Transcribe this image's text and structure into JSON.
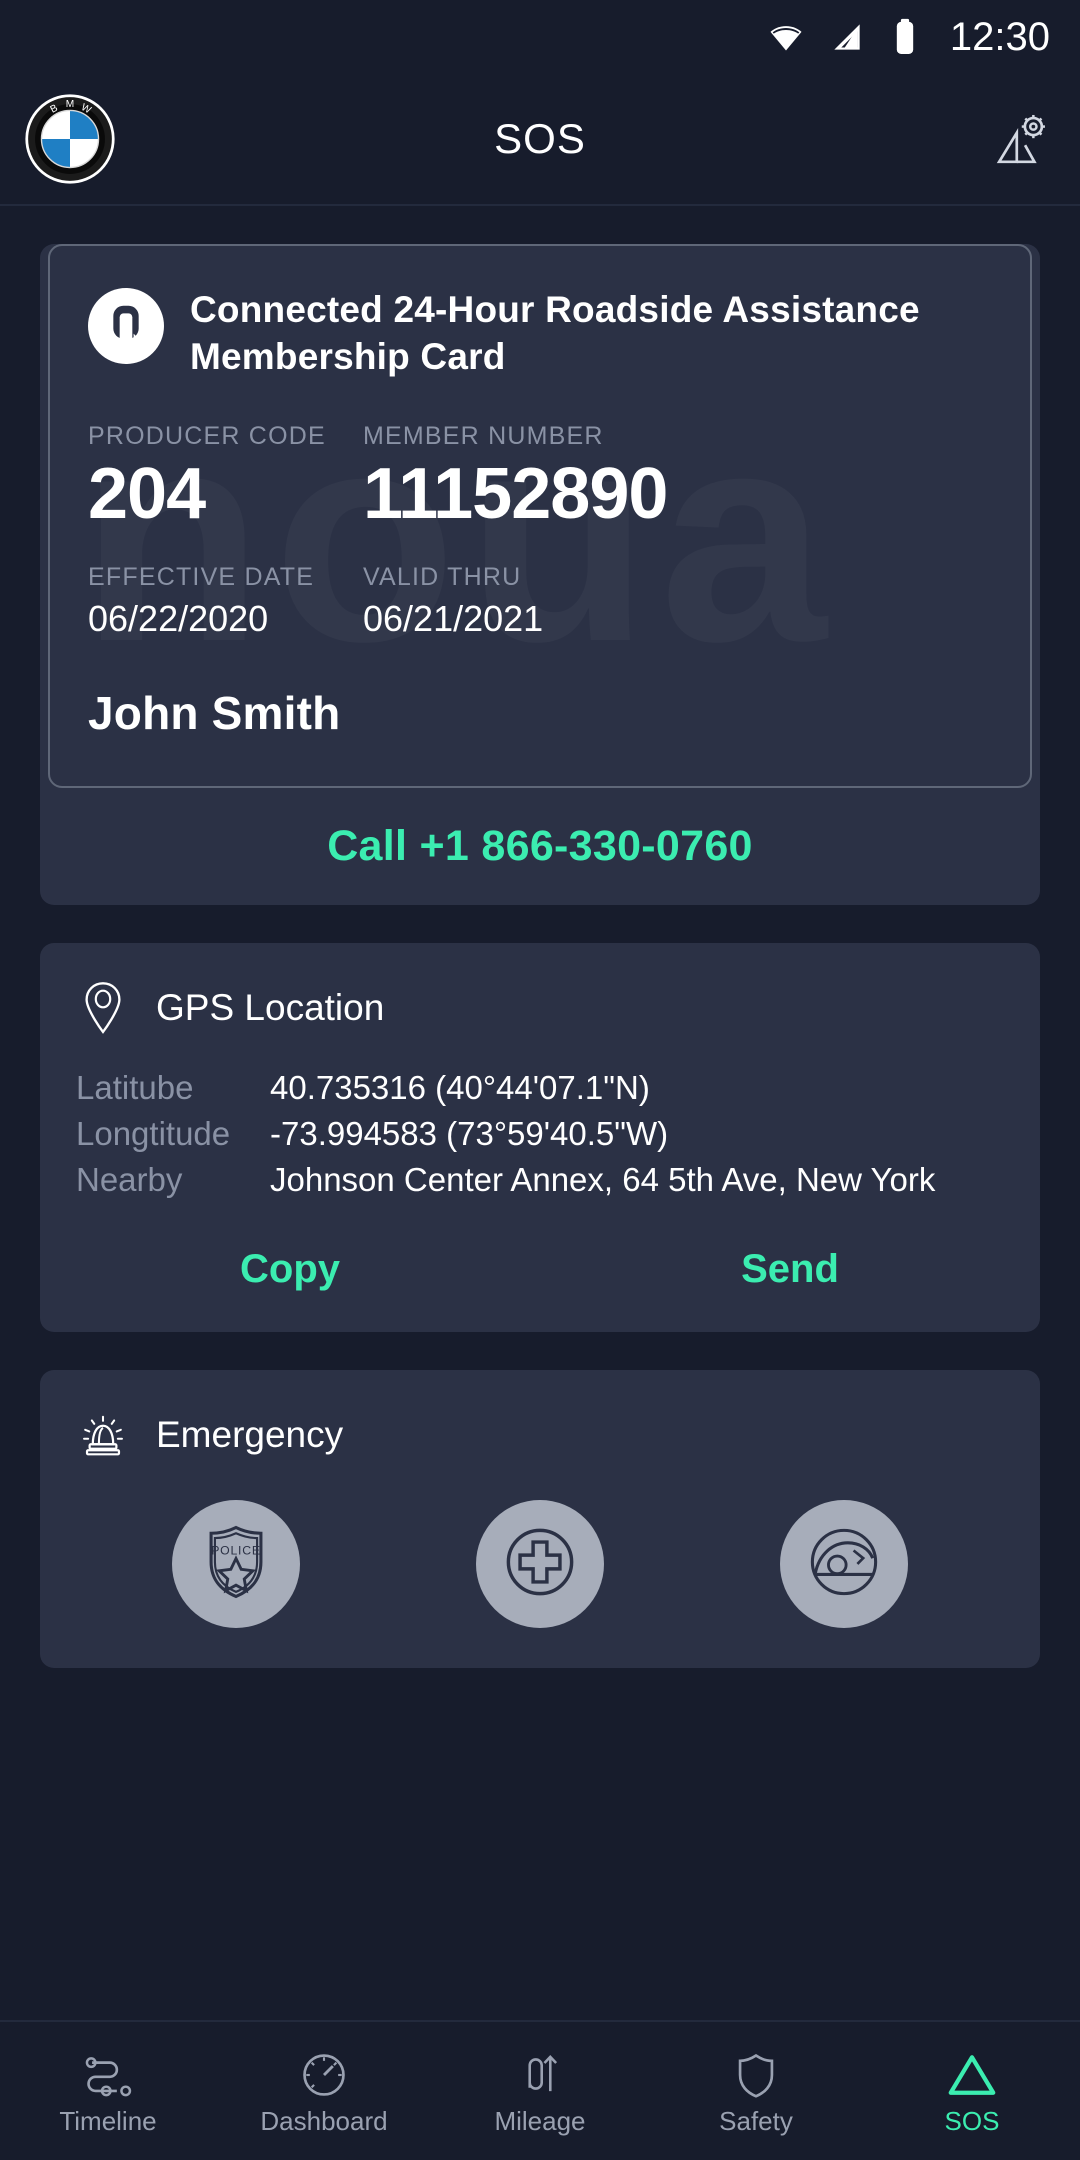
{
  "status_bar": {
    "time": "12:30",
    "icons": [
      "wifi-icon",
      "cellular-signal-icon",
      "battery-icon"
    ]
  },
  "app_bar": {
    "logo": "bmw-logo",
    "title": "SOS",
    "action_icon": "warning-triangle-gear-icon"
  },
  "membership_card": {
    "brand_icon": "roadside-assistance-logo",
    "title": "Connected 24-Hour Roadside Assistance Membership Card",
    "watermark_text": "noua",
    "producer_code_label": "PRODUCER CODE",
    "producer_code_value": "204",
    "member_number_label": "MEMBER NUMBER",
    "member_number_value": "11152890",
    "effective_date_label": "EFFECTIVE DATE",
    "effective_date_value": "06/22/2020",
    "valid_thru_label": "VALID THRU",
    "valid_thru_value": "06/21/2021",
    "member_name": "John Smith",
    "call_label": "Call +1 866-330-0760"
  },
  "gps": {
    "icon": "map-pin-icon",
    "title": "GPS Location",
    "rows": [
      {
        "label": "Latitube",
        "value": "40.735316 (40°44'07.1\"N)"
      },
      {
        "label": "Longtitude",
        "value": "-73.994583 (73°59'40.5\"W)"
      },
      {
        "label": "Nearby",
        "value": "Johnson Center Annex, 64 5th Ave, New York"
      }
    ],
    "copy_label": "Copy",
    "send_label": "Send"
  },
  "emergency": {
    "icon": "siren-icon",
    "title": "Emergency",
    "buttons": [
      {
        "name": "police-badge-icon"
      },
      {
        "name": "medical-cross-icon"
      },
      {
        "name": "fire-helmet-icon"
      }
    ]
  },
  "bottom_nav": {
    "items": [
      {
        "label": "Timeline",
        "icon": "timeline-icon",
        "active": false
      },
      {
        "label": "Dashboard",
        "icon": "gauge-icon",
        "active": false
      },
      {
        "label": "Mileage",
        "icon": "mileage-icon",
        "active": false
      },
      {
        "label": "Safety",
        "icon": "shield-icon",
        "active": false
      },
      {
        "label": "SOS",
        "icon": "triangle-icon",
        "active": true
      }
    ]
  },
  "colors": {
    "background": "#171c2c",
    "panel": "#2b3145",
    "accent": "#3bedb0",
    "muted_text": "#8a92a5",
    "text": "#ffffff"
  }
}
